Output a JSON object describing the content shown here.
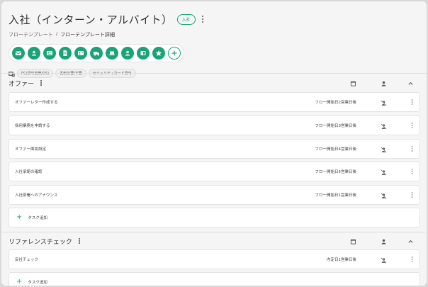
{
  "header": {
    "title": "入社（インターン・アルバイト）",
    "badge": "入社",
    "breadcrumb": {
      "parent": "フローテンプレート",
      "separator": "/",
      "current": "フローテンプレート詳細"
    },
    "icons": [
      "mail-icon",
      "person-icon",
      "id-card-icon",
      "document-icon",
      "badge-card-icon",
      "truck-icon",
      "laptop-icon",
      "person-icon",
      "panel-icon",
      "star-icon",
      "add-icon"
    ]
  },
  "conditions": {
    "chips": [
      "PC(貸与有無/OS)",
      "名刺の要/不要",
      "セキュリティカード貸与"
    ]
  },
  "sections": [
    {
      "title": "オファー",
      "tasks": [
        {
          "name": "オファーレター作成する",
          "due": "フロー開始日2営業日後"
        },
        {
          "name": "採用業務を申請する",
          "due": "フロー開始日3営業日後"
        },
        {
          "name": "オファー面談設定",
          "due": "フロー開始日4営業日後"
        },
        {
          "name": "入社承諾の確認",
          "due": "フロー開始日5営業日後"
        },
        {
          "name": "入社部署へのアナウンス",
          "due": "フロー開始日1営業日後"
        }
      ],
      "add_label": "タスク追加"
    },
    {
      "title": "リファレンスチェック",
      "tasks": [
        {
          "name": "反社チェック",
          "due": "内定日1営業日後"
        }
      ],
      "add_label": "タスク追加"
    }
  ],
  "colors": {
    "accent": "#19a476",
    "background": "#f5f5f5"
  }
}
